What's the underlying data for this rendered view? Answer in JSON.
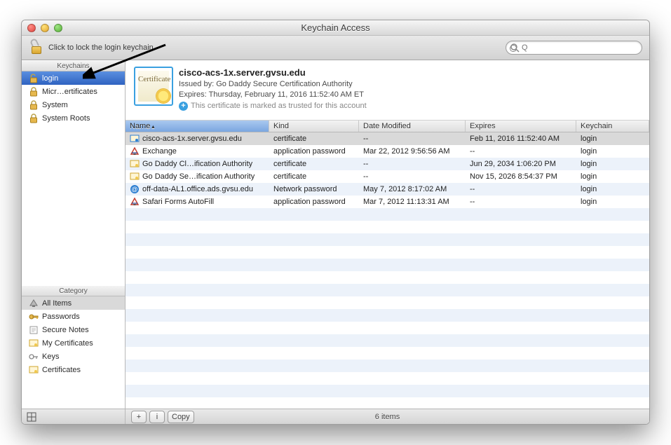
{
  "window": {
    "title": "Keychain Access"
  },
  "toolbar": {
    "lock_hint": "Click to lock the login keychain.",
    "search_placeholder": "Q"
  },
  "sidebar": {
    "keychains_header": "Keychains",
    "category_header": "Category",
    "keychains": [
      {
        "label": "login",
        "icon": "unlock-icon",
        "selected": true
      },
      {
        "label": "Micr…ertificates",
        "icon": "lock-icon",
        "selected": false
      },
      {
        "label": "System",
        "icon": "lock-icon",
        "selected": false
      },
      {
        "label": "System Roots",
        "icon": "lock-icon",
        "selected": false
      }
    ],
    "categories": [
      {
        "label": "All Items",
        "icon": "triangle-icon",
        "selected": true
      },
      {
        "label": "Passwords",
        "icon": "key-icon",
        "selected": false
      },
      {
        "label": "Secure Notes",
        "icon": "note-icon",
        "selected": false
      },
      {
        "label": "My Certificates",
        "icon": "cert-icon",
        "selected": false
      },
      {
        "label": "Keys",
        "icon": "key-outline-icon",
        "selected": false
      },
      {
        "label": "Certificates",
        "icon": "cert-icon",
        "selected": false
      }
    ]
  },
  "detail": {
    "title": "cisco-acs-1x.server.gvsu.edu",
    "issued_by_label": "Issued by:",
    "issued_by": "Go Daddy Secure Certification Authority",
    "expires_label": "Expires:",
    "expires": "Thursday, February 11, 2016 11:52:40 AM ET",
    "trust_text": "This certificate is marked as trusted for this account"
  },
  "table": {
    "headers": {
      "name": "Name",
      "kind": "Kind",
      "modified": "Date Modified",
      "expires": "Expires",
      "keychain": "Keychain"
    },
    "rows": [
      {
        "name": "cisco-acs-1x.server.gvsu.edu",
        "icon": "cert-blue-icon",
        "kind": "certificate",
        "modified": "--",
        "expires": "Feb 11, 2016 11:52:40 AM",
        "keychain": "login",
        "selected": true
      },
      {
        "name": "Exchange",
        "icon": "app-icon",
        "kind": "application password",
        "modified": "Mar 22, 2012 9:56:56 AM",
        "expires": "--",
        "keychain": "login",
        "selected": false
      },
      {
        "name": "Go Daddy Cl…ification Authority",
        "icon": "cert-yellow-icon",
        "kind": "certificate",
        "modified": "--",
        "expires": "Jun 29, 2034 1:06:20 PM",
        "keychain": "login",
        "selected": false
      },
      {
        "name": "Go Daddy Se…ification Authority",
        "icon": "cert-yellow-icon",
        "kind": "certificate",
        "modified": "--",
        "expires": "Nov 15, 2026 8:54:37 PM",
        "keychain": "login",
        "selected": false
      },
      {
        "name": "off-data-AL1.office.ads.gvsu.edu",
        "icon": "at-icon",
        "kind": "Network password",
        "modified": "May 7, 2012 8:17:02 AM",
        "expires": "--",
        "keychain": "login",
        "selected": false
      },
      {
        "name": "Safari Forms AutoFill",
        "icon": "app-icon",
        "kind": "application password",
        "modified": "Mar 7, 2012 11:13:31 AM",
        "expires": "--",
        "keychain": "login",
        "selected": false
      }
    ]
  },
  "status": {
    "items_text": "6 items",
    "copy_label": "Copy",
    "plus_label": "+",
    "info_label": "i"
  }
}
